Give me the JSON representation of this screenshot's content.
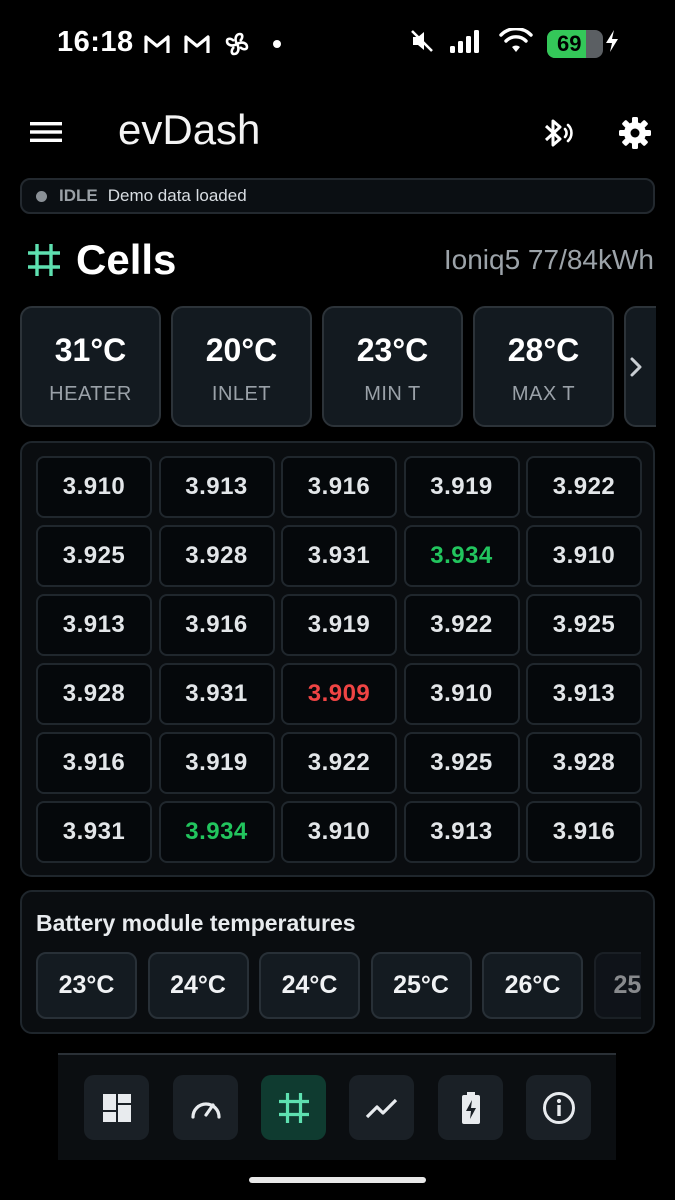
{
  "status_bar": {
    "time": "16:18",
    "left_icons": [
      "gmail-icon",
      "gmail-icon",
      "fan-icon",
      "dot-icon"
    ],
    "battery_level": "69",
    "battery_fraction": 0.69,
    "colors": {
      "battery": "#34c759"
    }
  },
  "app_bar": {
    "title": "evDash",
    "icons": [
      "menu-icon",
      "bluetooth-icon",
      "gear-icon"
    ]
  },
  "status": {
    "state": "IDLE",
    "message": "Demo data loaded"
  },
  "section": {
    "title": "Cells",
    "icon": "grid-icon",
    "vehicle": "Ioniq5 77/84kWh"
  },
  "stats": [
    {
      "value": "31°C",
      "label": "HEATER"
    },
    {
      "value": "20°C",
      "label": "INLET"
    },
    {
      "value": "23°C",
      "label": "MIN T"
    },
    {
      "value": "28°C",
      "label": "MAX T"
    }
  ],
  "cells": [
    {
      "v": "3.910",
      "s": ""
    },
    {
      "v": "3.913",
      "s": ""
    },
    {
      "v": "3.916",
      "s": ""
    },
    {
      "v": "3.919",
      "s": ""
    },
    {
      "v": "3.922",
      "s": ""
    },
    {
      "v": "3.925",
      "s": ""
    },
    {
      "v": "3.928",
      "s": ""
    },
    {
      "v": "3.931",
      "s": ""
    },
    {
      "v": "3.934",
      "s": "high"
    },
    {
      "v": "3.910",
      "s": ""
    },
    {
      "v": "3.913",
      "s": ""
    },
    {
      "v": "3.916",
      "s": ""
    },
    {
      "v": "3.919",
      "s": ""
    },
    {
      "v": "3.922",
      "s": ""
    },
    {
      "v": "3.925",
      "s": ""
    },
    {
      "v": "3.928",
      "s": ""
    },
    {
      "v": "3.931",
      "s": ""
    },
    {
      "v": "3.909",
      "s": "low"
    },
    {
      "v": "3.910",
      "s": ""
    },
    {
      "v": "3.913",
      "s": ""
    },
    {
      "v": "3.916",
      "s": ""
    },
    {
      "v": "3.919",
      "s": ""
    },
    {
      "v": "3.922",
      "s": ""
    },
    {
      "v": "3.925",
      "s": ""
    },
    {
      "v": "3.928",
      "s": ""
    },
    {
      "v": "3.931",
      "s": ""
    },
    {
      "v": "3.934",
      "s": "high"
    },
    {
      "v": "3.910",
      "s": ""
    },
    {
      "v": "3.913",
      "s": ""
    },
    {
      "v": "3.916",
      "s": ""
    }
  ],
  "modules": {
    "title": "Battery module temperatures",
    "temps": [
      "23°C",
      "24°C",
      "24°C",
      "25°C",
      "26°C",
      "25"
    ]
  },
  "bottom_nav": {
    "items": [
      {
        "icon": "dashboard-icon",
        "active": false
      },
      {
        "icon": "speedometer-icon",
        "active": false
      },
      {
        "icon": "grid-icon",
        "active": true
      },
      {
        "icon": "chart-line-icon",
        "active": false
      },
      {
        "icon": "battery-charging-icon",
        "active": false
      },
      {
        "icon": "info-icon",
        "active": false
      }
    ]
  },
  "colors": {
    "accent": "#5ee0b0",
    "cell_high": "#22c55e",
    "cell_low": "#ef4444"
  }
}
